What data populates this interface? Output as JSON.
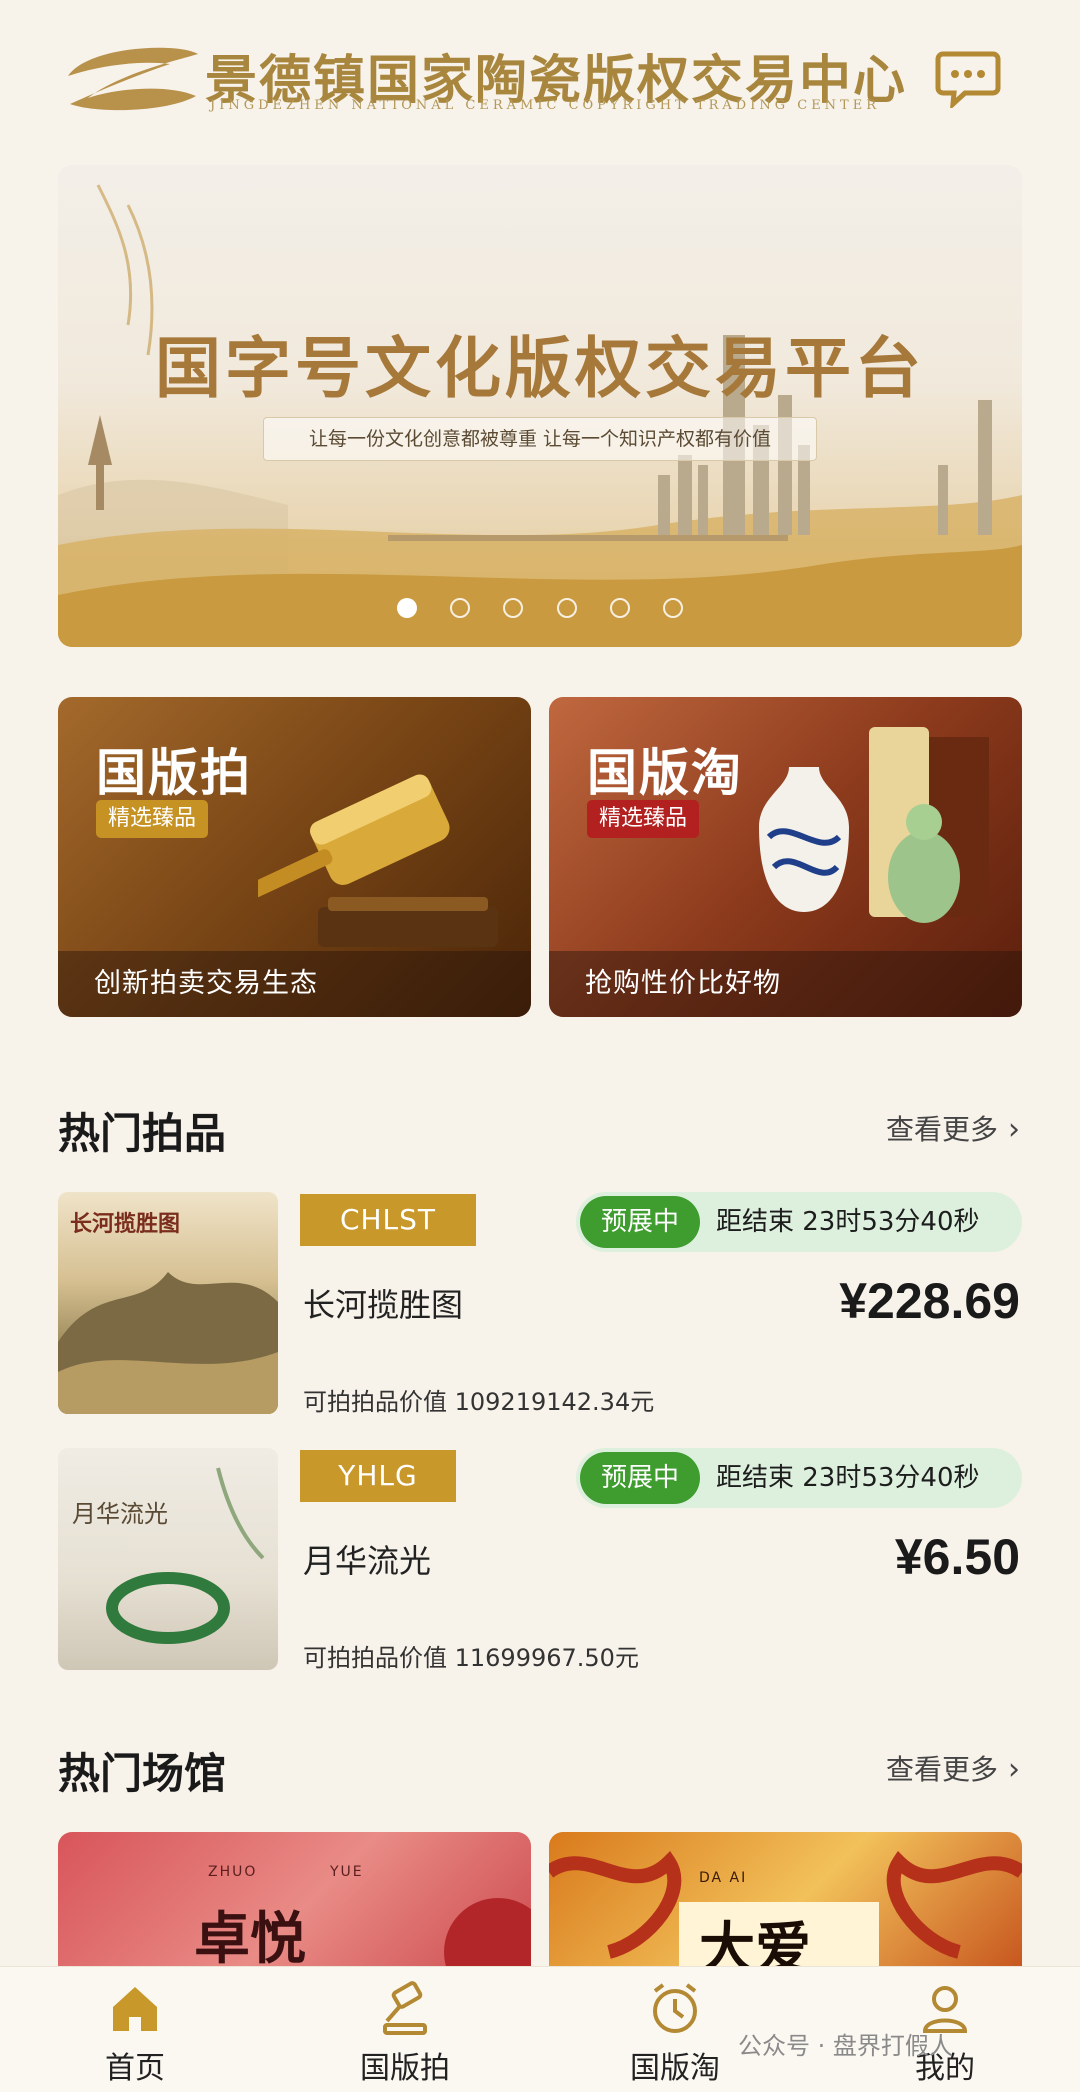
{
  "header": {
    "title": "景德镇国家陶瓷版权交易中心",
    "subtitle": "JINGDEZHEN NATIONAL CERAMIC COPYRIGHT TRADING CENTER",
    "message_icon": "chat-bubble-icon"
  },
  "banner": {
    "title": "国字号文化版权交易平台",
    "subtitle": "让每一份文化创意都被尊重 让每一个知识产权都有价值",
    "slide_count": 6,
    "active_slide": 1
  },
  "categories": [
    {
      "title": "国版拍",
      "badge": "精选臻品",
      "footer": "创新拍卖交易生态",
      "icon": "gavel-icon"
    },
    {
      "title": "国版淘",
      "badge": "精选臻品",
      "footer": "抢购性价比好物",
      "icon": "vase-icon"
    }
  ],
  "hot_lots": {
    "title": "热门拍品",
    "more": "查看更多",
    "items": [
      {
        "code": "CHLST",
        "status": "预展中",
        "countdown": "距结束 23时53分40秒",
        "name": "长河揽胜图",
        "price": "¥228.69",
        "value": "可拍拍品价值 109219142.34元",
        "thumb_text": "长河揽胜图"
      },
      {
        "code": "YHLG",
        "status": "预展中",
        "countdown": "距结束 23时53分40秒",
        "name": "月华流光",
        "price": "¥6.50",
        "value": "可拍拍品价值 11699967.50元",
        "thumb_text": "月华流光"
      }
    ]
  },
  "hot_venues": {
    "title": "热门场馆",
    "more": "查看更多",
    "items": [
      {
        "name": "卓悦",
        "pinyin_left": "ZHUO",
        "pinyin_right": "YUE"
      },
      {
        "name": "大爱",
        "pinyin_left": "DA AI"
      }
    ]
  },
  "tabbar": [
    {
      "label": "首页",
      "icon": "home-icon",
      "active": true
    },
    {
      "label": "国版拍",
      "icon": "gavel-icon",
      "active": false
    },
    {
      "label": "国版淘",
      "icon": "clock-icon",
      "active": false
    },
    {
      "label": "我的",
      "icon": "user-icon",
      "active": false
    }
  ],
  "watermark": "公众号 · 盘界打假人",
  "colors": {
    "gold": "#c9982a",
    "green": "#3f9c2f",
    "red_badge": "#b2201f",
    "background": "#f7f2ea"
  }
}
